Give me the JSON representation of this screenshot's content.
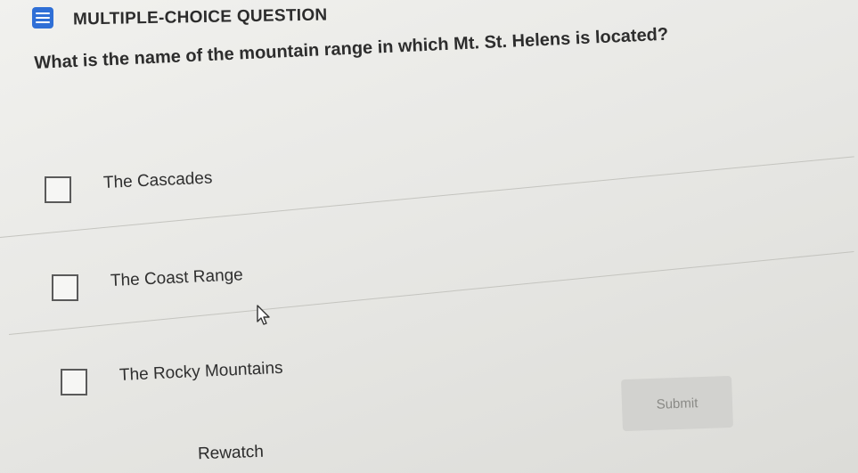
{
  "header": {
    "icon": "list-icon",
    "title": "MULTIPLE-CHOICE QUESTION",
    "accent_color": "#2f6fd6"
  },
  "question": {
    "text": "What is the name of the mountain range in which Mt. St. Helens is located?"
  },
  "options": [
    {
      "label": "The Cascades",
      "checked": false
    },
    {
      "label": "The Coast Range",
      "checked": false
    },
    {
      "label": "The Rocky Mountains",
      "checked": false
    }
  ],
  "actions": {
    "submit_label": "Submit",
    "rewatch_label": "Rewatch"
  }
}
